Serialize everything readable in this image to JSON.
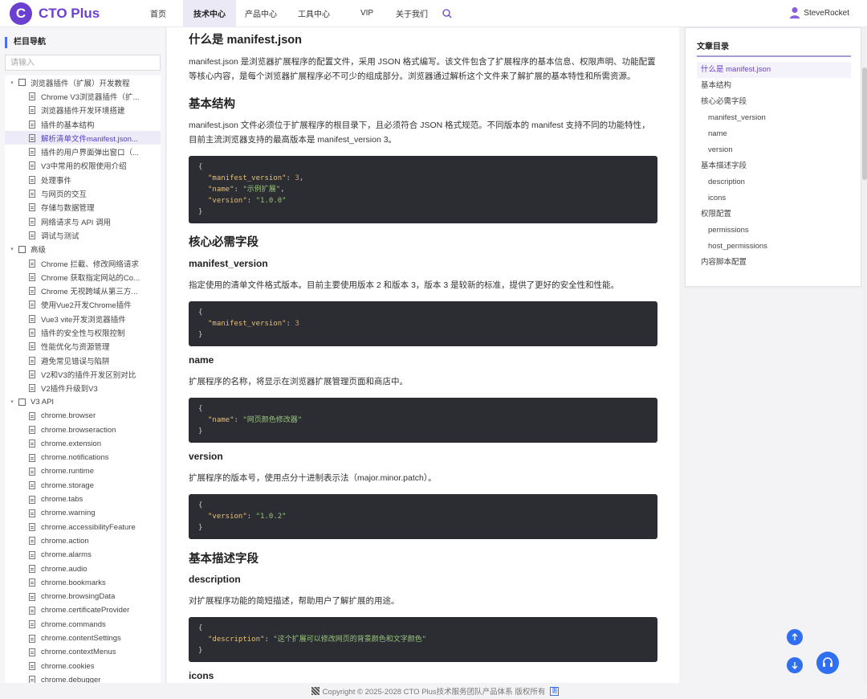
{
  "header": {
    "logo_text": "CTO Plus",
    "logo_mark": "C",
    "nav": [
      "首页",
      "技术中心",
      "产品中心",
      "工具中心",
      "VIP",
      "关于我们"
    ],
    "active_nav": 1,
    "user_name": "SteveRocket",
    "accent": "#6b3fd0"
  },
  "sidebar": {
    "title": "栏目导航",
    "search_placeholder": "请输入",
    "tree": [
      {
        "level": 0,
        "label": "浏览器插件（扩展）开发教程",
        "folder": true
      },
      {
        "level": 1,
        "label": "Chrome V3浏览器插件（扩..."
      },
      {
        "level": 1,
        "label": "浏览器插件开发环境搭建"
      },
      {
        "level": 1,
        "label": "插件的基本结构"
      },
      {
        "level": 1,
        "label": "解析清单文件manifest.json...",
        "selected": true
      },
      {
        "level": 1,
        "label": "插件的用户界面弹出窗口（..."
      },
      {
        "level": 1,
        "label": "V3中常用的权限使用介绍"
      },
      {
        "level": 1,
        "label": "处理事件"
      },
      {
        "level": 1,
        "label": "与网页的交互"
      },
      {
        "level": 1,
        "label": "存储与数据管理"
      },
      {
        "level": 1,
        "label": "网络请求与 API 调用"
      },
      {
        "level": 1,
        "label": "调试与测试"
      },
      {
        "level": 0,
        "label": "高级",
        "folder": true
      },
      {
        "level": 1,
        "label": "Chrome 拦截、修改网络请求"
      },
      {
        "level": 1,
        "label": "Chrome 获取指定网站的Co..."
      },
      {
        "level": 1,
        "label": "Chrome 无视跨域从第三方..."
      },
      {
        "level": 1,
        "label": "使用Vue2开发Chrome插件"
      },
      {
        "level": 1,
        "label": "Vue3 vite开发浏览器插件"
      },
      {
        "level": 1,
        "label": "插件的安全性与权限控制"
      },
      {
        "level": 1,
        "label": "性能优化与资源管理"
      },
      {
        "level": 1,
        "label": "避免常见错误与陷阱"
      },
      {
        "level": 1,
        "label": "V2和V3的插件开发区别对比"
      },
      {
        "level": 1,
        "label": "V2插件升级到V3"
      },
      {
        "level": 0,
        "label": "V3 API",
        "folder": true
      },
      {
        "level": 1,
        "label": "chrome.browser"
      },
      {
        "level": 1,
        "label": "chrome.browseraction"
      },
      {
        "level": 1,
        "label": "chrome.extension"
      },
      {
        "level": 1,
        "label": "chrome.notifications"
      },
      {
        "level": 1,
        "label": "chrome.runtime"
      },
      {
        "level": 1,
        "label": "chrome.storage"
      },
      {
        "level": 1,
        "label": "chrome.tabs"
      },
      {
        "level": 1,
        "label": "chrome.warning"
      },
      {
        "level": 1,
        "label": "chrome.accessibilityFeature"
      },
      {
        "level": 1,
        "label": "chrome.action"
      },
      {
        "level": 1,
        "label": "chrome.alarms"
      },
      {
        "level": 1,
        "label": "chrome.audio"
      },
      {
        "level": 1,
        "label": "chrome.bookmarks"
      },
      {
        "level": 1,
        "label": "chrome.browsingData"
      },
      {
        "level": 1,
        "label": "chrome.certificateProvider"
      },
      {
        "level": 1,
        "label": "chrome.commands"
      },
      {
        "level": 1,
        "label": "chrome.contentSettings"
      },
      {
        "level": 1,
        "label": "chrome.contextMenus"
      },
      {
        "level": 1,
        "label": "chrome.cookies"
      },
      {
        "level": 1,
        "label": "chrome.debugger"
      }
    ]
  },
  "article": {
    "h_what": "什么是 manifest.json",
    "p_what": "manifest.json 是浏览器扩展程序的配置文件，采用 JSON 格式编写。该文件包含了扩展程序的基本信息、权限声明、功能配置等核心内容，是每个浏览器扩展程序必不可少的组成部分。浏览器通过解析这个文件来了解扩展的基本特性和所需资源。",
    "h_basic": "基本结构",
    "p_basic": "manifest.json 文件必须位于扩展程序的根目录下，且必须符合 JSON 格式规范。不同版本的 manifest 支持不同的功能特性，目前主流浏览器支持的最高版本是 manifest_version 3。",
    "code1": {
      "open": "{",
      "l1k": "\"manifest_version\"",
      "l1v": "3",
      "l2k": "\"name\"",
      "l2v": "\"示例扩展\"",
      "l3k": "\"version\"",
      "l3v": "\"1.0.0\"",
      "close": "}"
    },
    "h_core": "核心必需字段",
    "h_mv": "manifest_version",
    "p_mv": "指定使用的清单文件格式版本。目前主要使用版本 2 和版本 3，版本 3 是较新的标准，提供了更好的安全性和性能。",
    "code2": {
      "open": "{",
      "k": "\"manifest_version\"",
      "v": "3",
      "close": "}"
    },
    "h_name": "name",
    "p_name": "扩展程序的名称，将显示在浏览器扩展管理页面和商店中。",
    "code3": {
      "open": "{",
      "k": "\"name\"",
      "v": "\"网页颜色修改器\"",
      "close": "}"
    },
    "h_version": "version",
    "p_version": "扩展程序的版本号，使用点分十进制表示法（major.minor.patch）。",
    "code4": {
      "open": "{",
      "k": "\"version\"",
      "v": "\"1.0.2\"",
      "close": "}"
    },
    "h_desc_fields": "基本描述字段",
    "h_description": "description",
    "p_description": "对扩展程序功能的简短描述，帮助用户了解扩展的用途。",
    "code5": {
      "open": "{",
      "k": "\"description\"",
      "v": "\"这个扩展可以修改网页的背景颜色和文字颜色\"",
      "close": "}"
    },
    "h_icons": "icons"
  },
  "toc": {
    "title": "文章目录",
    "items": [
      {
        "label": "什么是 manifest.json",
        "sub": false,
        "active": true
      },
      {
        "label": "基本结构",
        "sub": false
      },
      {
        "label": "核心必需字段",
        "sub": false
      },
      {
        "label": "manifest_version",
        "sub": true
      },
      {
        "label": "name",
        "sub": true
      },
      {
        "label": "version",
        "sub": true
      },
      {
        "label": "基本描述字段",
        "sub": false
      },
      {
        "label": "description",
        "sub": true
      },
      {
        "label": "icons",
        "sub": true
      },
      {
        "label": "权限配置",
        "sub": false
      },
      {
        "label": "permissions",
        "sub": true
      },
      {
        "label": "host_permissions",
        "sub": true
      },
      {
        "label": "内容脚本配置",
        "sub": false
      }
    ]
  },
  "footer": {
    "copyright": "Copyright © 2025-2028 CTO Plus技术服务团队产品体系 版权所有",
    "badge": "惠"
  },
  "icons": {
    "search": "search-icon",
    "user": "user-icon",
    "up": "arrow-up-icon",
    "down": "arrow-down-icon",
    "support": "headset-icon"
  }
}
